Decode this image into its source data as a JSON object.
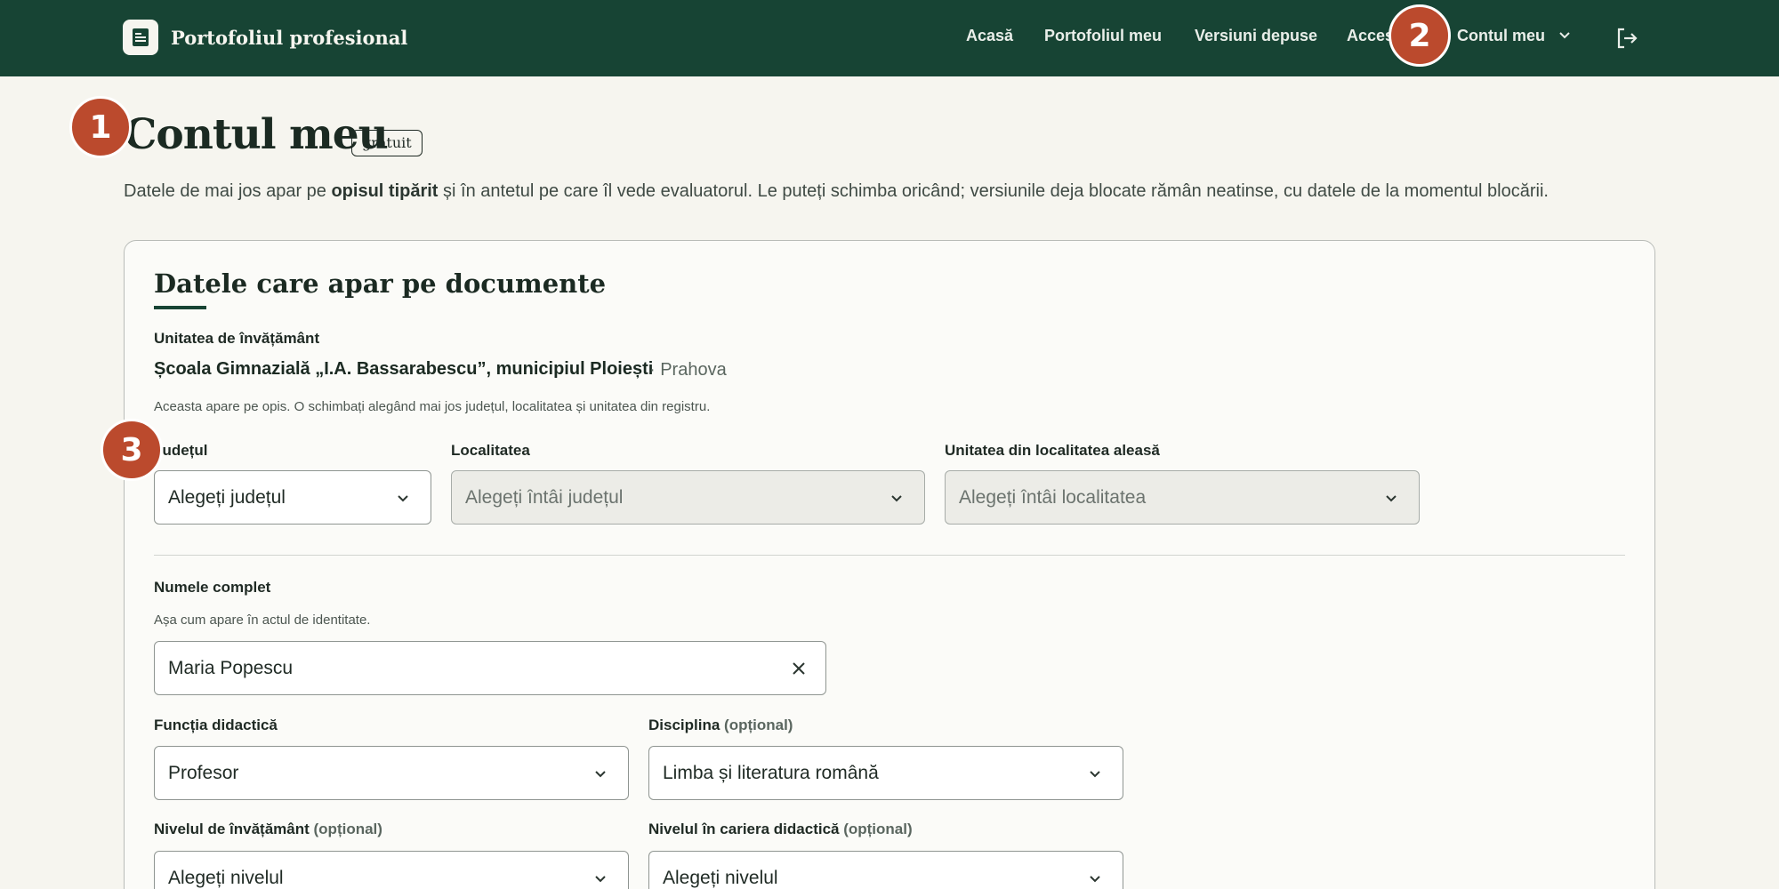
{
  "header": {
    "brand": "Portofoliul profesional",
    "nav": [
      "Acasă",
      "Portofoliul meu",
      "Versiuni depuse",
      "Acces",
      "Contul meu"
    ]
  },
  "badges": [
    "1",
    "2",
    "3"
  ],
  "page": {
    "title": "Contul meu",
    "plan": "gratuit",
    "lead_before": "Datele de mai jos apar pe ",
    "lead_bold": "opisul tipărit",
    "lead_after": " și în antetul pe care îl vede evaluatorul. Le puteți schimba oricând; versiunile deja blocate rămân neatinse, cu datele de la momentul blocării."
  },
  "card": {
    "title": "Datele care apar pe documente",
    "unit_label": "Unitatea de învățământ",
    "unit_name": "Școala Gimnazială „I.A. Bassarabescu”, municipiul Ploiești",
    "unit_county": "· Prahova",
    "unit_hint": "Aceasta apare pe opis. O schimbați alegând mai jos județul, localitatea și unitatea din registru.",
    "county_label": "Județul",
    "county_value": "Alegeți județul",
    "locality_label": "Localitatea",
    "locality_value": "Alegeți întâi județul",
    "school_label": "Unitatea din localitatea aleasă",
    "school_value": "Alegeți întâi localitatea",
    "name_label": "Numele complet",
    "name_hint": "Așa cum apare în actul de identitate.",
    "name_value": "Maria Popescu",
    "function_label": "Funcția didactică",
    "function_value": "Profesor",
    "discipline_label": "Disciplina",
    "discipline_value": "Limba și literatura română",
    "level_label": "Nivelul de învățământ",
    "level_value": "Alegeți nivelul",
    "career_label": "Nivelul în cariera didactică",
    "career_value": "Alegeți nivelul",
    "optional": "(opțional)"
  },
  "colors": {
    "header": "#174434",
    "accent": "#bb4a2d",
    "background": "#f6f5ef"
  }
}
